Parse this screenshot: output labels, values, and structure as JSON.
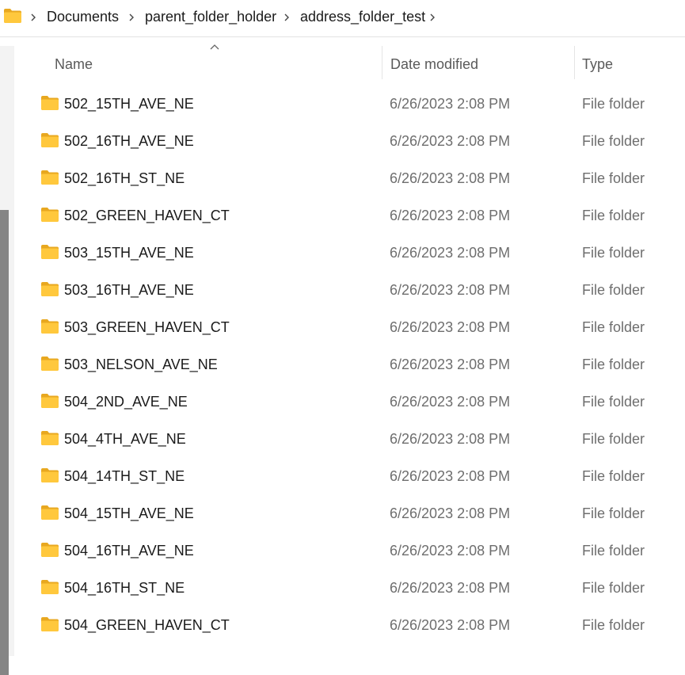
{
  "breadcrumb": {
    "items": [
      "Documents",
      "parent_folder_holder",
      "address_folder_test"
    ]
  },
  "columns": {
    "name": "Name",
    "date_modified": "Date modified",
    "type": "Type",
    "sort": "ascending"
  },
  "rows": [
    {
      "name": "502_15TH_AVE_NE",
      "date": "6/26/2023 2:08 PM",
      "type": "File folder"
    },
    {
      "name": "502_16TH_AVE_NE",
      "date": "6/26/2023 2:08 PM",
      "type": "File folder"
    },
    {
      "name": "502_16TH_ST_NE",
      "date": "6/26/2023 2:08 PM",
      "type": "File folder"
    },
    {
      "name": "502_GREEN_HAVEN_CT",
      "date": "6/26/2023 2:08 PM",
      "type": "File folder"
    },
    {
      "name": "503_15TH_AVE_NE",
      "date": "6/26/2023 2:08 PM",
      "type": "File folder"
    },
    {
      "name": "503_16TH_AVE_NE",
      "date": "6/26/2023 2:08 PM",
      "type": "File folder"
    },
    {
      "name": "503_GREEN_HAVEN_CT",
      "date": "6/26/2023 2:08 PM",
      "type": "File folder"
    },
    {
      "name": "503_NELSON_AVE_NE",
      "date": "6/26/2023 2:08 PM",
      "type": "File folder"
    },
    {
      "name": "504_2ND_AVE_NE",
      "date": "6/26/2023 2:08 PM",
      "type": "File folder"
    },
    {
      "name": "504_4TH_AVE_NE",
      "date": "6/26/2023 2:08 PM",
      "type": "File folder"
    },
    {
      "name": "504_14TH_ST_NE",
      "date": "6/26/2023 2:08 PM",
      "type": "File folder"
    },
    {
      "name": "504_15TH_AVE_NE",
      "date": "6/26/2023 2:08 PM",
      "type": "File folder"
    },
    {
      "name": "504_16TH_AVE_NE",
      "date": "6/26/2023 2:08 PM",
      "type": "File folder"
    },
    {
      "name": "504_16TH_ST_NE",
      "date": "6/26/2023 2:08 PM",
      "type": "File folder"
    },
    {
      "name": "504_GREEN_HAVEN_CT",
      "date": "6/26/2023 2:08 PM",
      "type": "File folder"
    }
  ],
  "icons": {
    "folder": "folder-icon",
    "separator": "chevron-right-icon",
    "sort": "chevron-up-icon"
  },
  "colors": {
    "folder_front": "#FFC83D",
    "folder_back": "#E8A820",
    "scrollbar_thumb": "#858585"
  }
}
